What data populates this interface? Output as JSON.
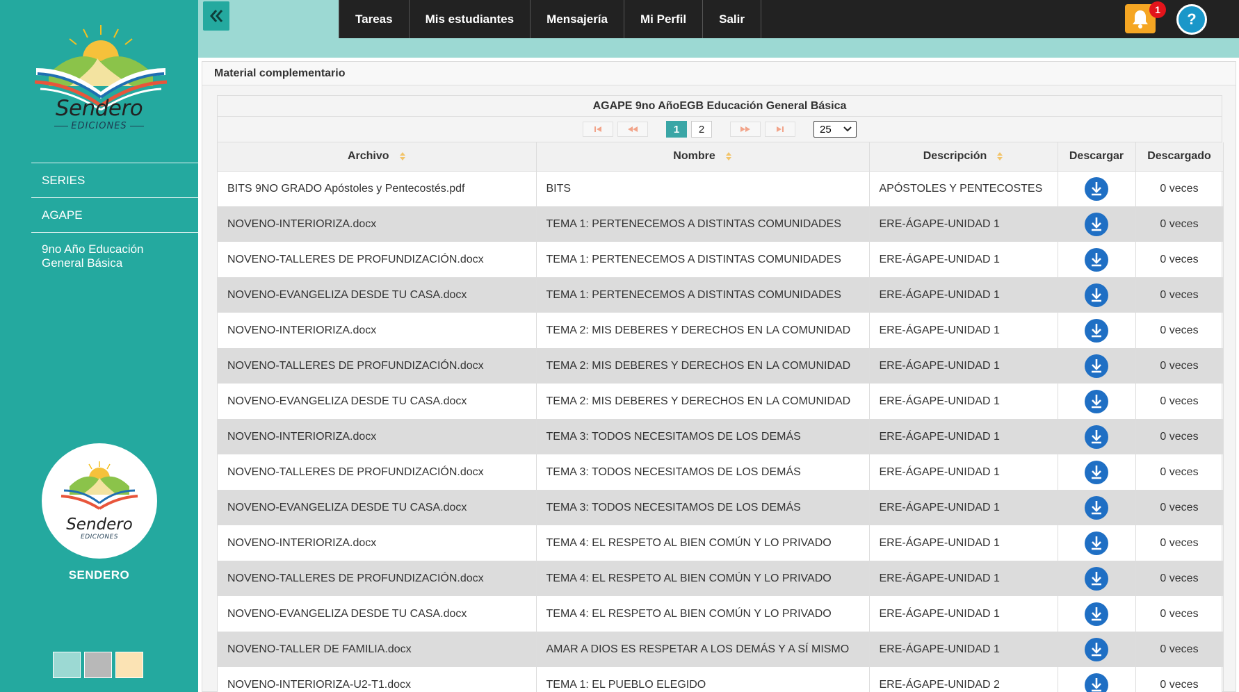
{
  "sidebar": {
    "brand_name": "Sendero",
    "brand_sub": "EDICIONES",
    "items": [
      {
        "label": "SERIES"
      },
      {
        "label": "AGAPE"
      },
      {
        "label": "9no Año Educación General Básica"
      }
    ],
    "footer_label": "SENDERO",
    "swatches": [
      "#9cd9d3",
      "#b8b8b8",
      "#fbe3b4"
    ]
  },
  "header": {
    "nav": [
      "Tareas",
      "Mis estudiantes",
      "Mensajería",
      "Mi Perfil",
      "Salir"
    ],
    "notification_count": "1",
    "help_label": "?"
  },
  "panel": {
    "title": "Material complementario",
    "grid_caption": "AGAPE 9no AñoEGB Educación General Básica",
    "pager": {
      "pages": [
        "1",
        "2"
      ],
      "current": "1",
      "page_size": "25"
    },
    "columns": [
      "Archivo",
      "Nombre",
      "Descripción",
      "Descargar",
      "Descargado"
    ],
    "rows": [
      {
        "archivo": "BITS 9NO GRADO Apóstoles y Pentecostés.pdf",
        "nombre": "BITS",
        "descripcion": "APÓSTOLES Y PENTECOSTES",
        "descargado": "0 veces"
      },
      {
        "archivo": "NOVENO-INTERIORIZA.docx",
        "nombre": "TEMA 1: PERTENECEMOS A DISTINTAS COMUNIDADES",
        "descripcion": "ERE-ÁGAPE-UNIDAD 1",
        "descargado": "0 veces"
      },
      {
        "archivo": "NOVENO-TALLERES DE PROFUNDIZACIÓN.docx",
        "nombre": "TEMA 1: PERTENECEMOS A DISTINTAS COMUNIDADES",
        "descripcion": "ERE-ÁGAPE-UNIDAD 1",
        "descargado": "0 veces"
      },
      {
        "archivo": "NOVENO-EVANGELIZA DESDE TU CASA.docx",
        "nombre": "TEMA 1: PERTENECEMOS A DISTINTAS COMUNIDADES",
        "descripcion": "ERE-ÁGAPE-UNIDAD 1",
        "descargado": "0 veces"
      },
      {
        "archivo": "NOVENO-INTERIORIZA.docx",
        "nombre": "TEMA 2: MIS DEBERES Y DERECHOS EN LA COMUNIDAD",
        "descripcion": "ERE-ÁGAPE-UNIDAD 1",
        "descargado": "0 veces"
      },
      {
        "archivo": "NOVENO-TALLERES DE PROFUNDIZACIÓN.docx",
        "nombre": "TEMA 2: MIS DEBERES Y DERECHOS EN LA COMUNIDAD",
        "descripcion": "ERE-ÁGAPE-UNIDAD 1",
        "descargado": "0 veces"
      },
      {
        "archivo": "NOVENO-EVANGELIZA DESDE TU CASA.docx",
        "nombre": "TEMA 2: MIS DEBERES Y DERECHOS EN LA COMUNIDAD",
        "descripcion": "ERE-ÁGAPE-UNIDAD 1",
        "descargado": "0 veces"
      },
      {
        "archivo": "NOVENO-INTERIORIZA.docx",
        "nombre": "TEMA 3: TODOS NECESITAMOS DE LOS DEMÁS",
        "descripcion": "ERE-ÁGAPE-UNIDAD 1",
        "descargado": "0 veces"
      },
      {
        "archivo": "NOVENO-TALLERES DE PROFUNDIZACIÓN.docx",
        "nombre": "TEMA 3: TODOS NECESITAMOS DE LOS DEMÁS",
        "descripcion": "ERE-ÁGAPE-UNIDAD 1",
        "descargado": "0 veces"
      },
      {
        "archivo": "NOVENO-EVANGELIZA DESDE TU CASA.docx",
        "nombre": "TEMA 3: TODOS NECESITAMOS DE LOS DEMÁS",
        "descripcion": "ERE-ÁGAPE-UNIDAD 1",
        "descargado": "0 veces"
      },
      {
        "archivo": "NOVENO-INTERIORIZA.docx",
        "nombre": "TEMA 4: EL RESPETO AL BIEN COMÚN Y LO PRIVADO",
        "descripcion": "ERE-ÁGAPE-UNIDAD 1",
        "descargado": "0 veces"
      },
      {
        "archivo": "NOVENO-TALLERES DE PROFUNDIZACIÓN.docx",
        "nombre": "TEMA 4: EL RESPETO AL BIEN COMÚN Y LO PRIVADO",
        "descripcion": "ERE-ÁGAPE-UNIDAD 1",
        "descargado": "0 veces"
      },
      {
        "archivo": "NOVENO-EVANGELIZA DESDE TU CASA.docx",
        "nombre": "TEMA 4: EL RESPETO AL BIEN COMÚN Y LO PRIVADO",
        "descripcion": "ERE-ÁGAPE-UNIDAD 1",
        "descargado": "0 veces"
      },
      {
        "archivo": "NOVENO-TALLER DE FAMILIA.docx",
        "nombre": "AMAR A DIOS ES RESPETAR A LOS DEMÁS Y A SÍ MISMO",
        "descripcion": "ERE-ÁGAPE-UNIDAD 1",
        "descargado": "0 veces"
      },
      {
        "archivo": "NOVENO-INTERIORIZA-U2-T1.docx",
        "nombre": "TEMA 1: EL PUEBLO ELEGIDO",
        "descripcion": "ERE-ÁGAPE-UNIDAD 2",
        "descargado": "0 veces"
      }
    ]
  }
}
